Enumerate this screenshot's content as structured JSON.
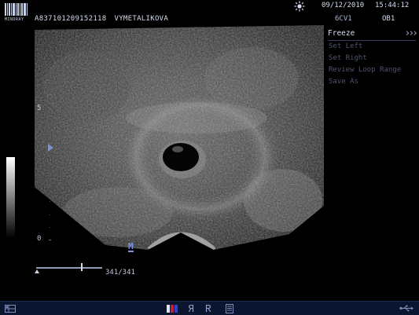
{
  "header": {
    "brand": "MINDRAY",
    "patient_id": "A837101209152118",
    "patient_name": "VYMETALIKOVA",
    "date": "09/12/2010",
    "time": "15:44:12",
    "probe": "6CV1",
    "preset": "OB1",
    "icons": {
      "brand": "barcode-logo-icon",
      "freeze_status": "sun-icon"
    }
  },
  "menu": {
    "title": "Freeze",
    "collapse_icon": "double-chevron-right-icon",
    "items": [
      "Set Left",
      "Set Right",
      "Review Loop Range",
      "Save As"
    ]
  },
  "image": {
    "depth_labels": [
      "5",
      "0"
    ],
    "mark_label": "M",
    "cine_frame": "341/341",
    "cine_position": 0.69
  },
  "taskbar": {
    "icons": [
      "grid-icon",
      "color-bar-icon",
      "flip-icon",
      "reverse-icon",
      "report-icon",
      "usb-icon"
    ],
    "flip_glyph": "Я",
    "reverse_glyph": "Я"
  },
  "colors": {
    "background": "#000000",
    "text": "#d3dcee",
    "menu_disabled": "#4c556a",
    "accent": "#7c93e0",
    "taskbar": "#0c1530"
  }
}
